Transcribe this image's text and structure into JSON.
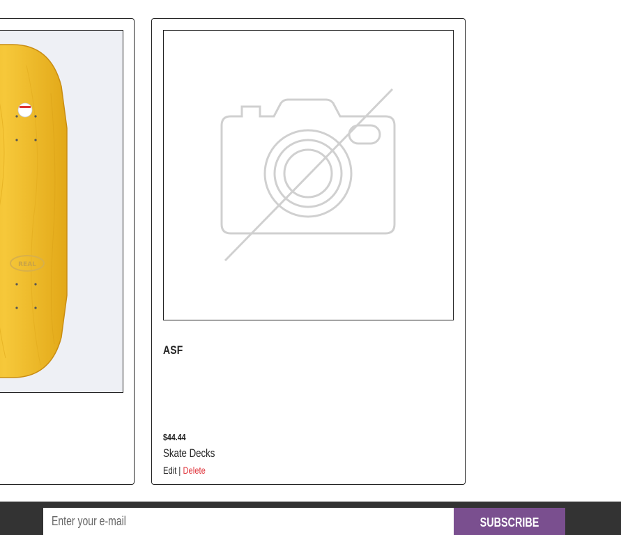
{
  "products": {
    "left": {
      "image_alt": "skateboard deck",
      "deck_logo": "REAL"
    },
    "middle": {
      "image_alt": "no image available",
      "title": "ASF",
      "price": "$44.44",
      "category": "Skate Decks",
      "edit_label": "Edit",
      "separator": "|",
      "delete_label": "Delete"
    }
  },
  "footer": {
    "email_placeholder": "Enter your e-mail",
    "subscribe_label": "SUBSCRIBE"
  },
  "colors": {
    "deck_yellow": "#f2c12e",
    "footer_bg": "#333333",
    "subscribe_bg": "#7a4f8f",
    "delete_red": "#e0343b"
  }
}
